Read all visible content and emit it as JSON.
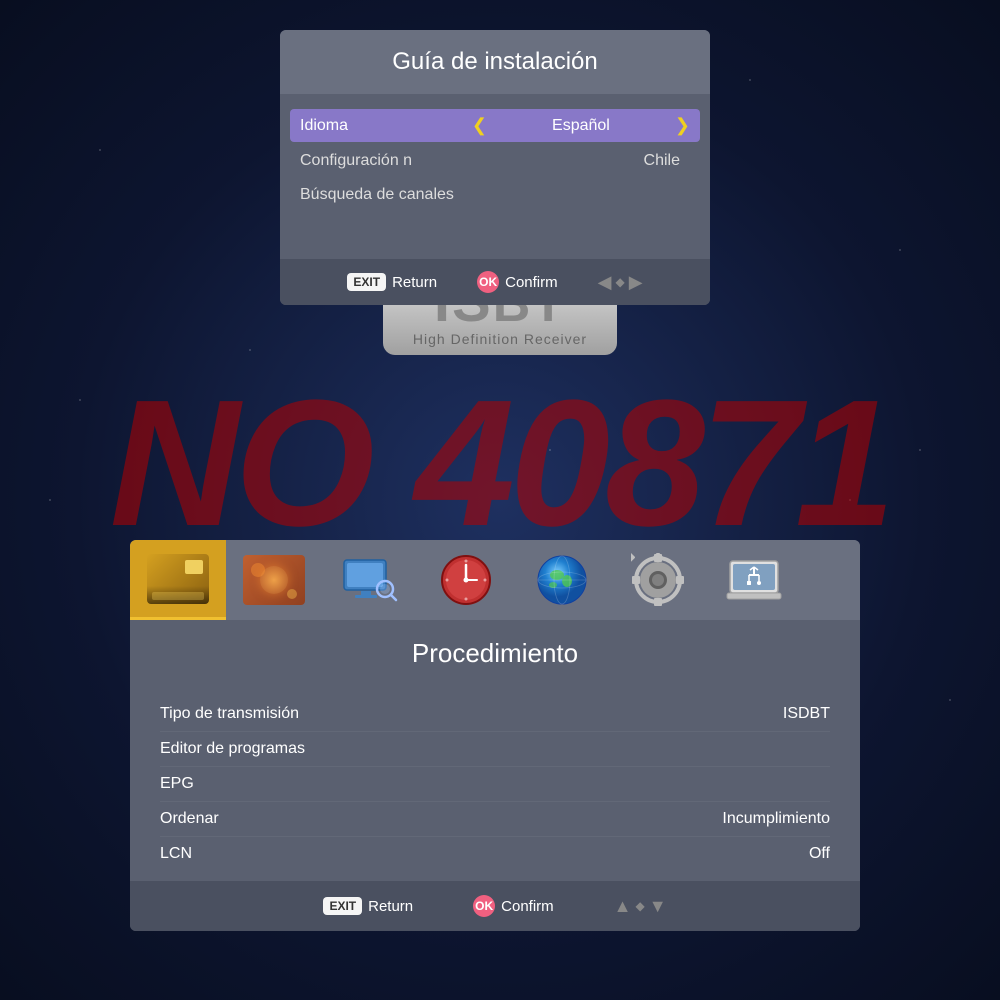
{
  "background": {
    "color": "#1a2540"
  },
  "watermark": {
    "text": "NO 40871"
  },
  "dialog_top": {
    "title": "Guía de instalación",
    "menu_items": [
      {
        "label": "Idioma",
        "value": "Español",
        "active": true,
        "has_arrows": true
      },
      {
        "label": "Configuración n",
        "value": "Chile",
        "active": false,
        "has_arrows": false
      },
      {
        "label": "Búsqueda de canales",
        "value": "",
        "active": false,
        "has_arrows": false
      }
    ],
    "footer": {
      "return_label": "Return",
      "confirm_label": "Confirm",
      "exit_badge": "EXIT",
      "ok_badge": "OK"
    }
  },
  "bottom_panel": {
    "icons": [
      {
        "name": "picture",
        "type": "picture",
        "selected": true
      },
      {
        "name": "bokeh",
        "type": "bokeh",
        "selected": false
      },
      {
        "name": "tv-search",
        "type": "tv-search",
        "selected": false
      },
      {
        "name": "clock",
        "type": "clock",
        "selected": false
      },
      {
        "name": "globe",
        "type": "globe",
        "selected": false
      },
      {
        "name": "gear",
        "type": "gear",
        "selected": false
      },
      {
        "name": "usb",
        "type": "usb",
        "selected": false
      }
    ],
    "title": "Procedimiento",
    "rows": [
      {
        "label": "Tipo de transmisión",
        "value": "ISDBT"
      },
      {
        "label": "Editor de programas",
        "value": ""
      },
      {
        "label": "EPG",
        "value": ""
      },
      {
        "label": "Ordenar",
        "value": "Incumplimiento"
      },
      {
        "label": "LCN",
        "value": "Off"
      }
    ],
    "footer": {
      "return_label": "Return",
      "confirm_label": "Confirm",
      "exit_badge": "EXIT",
      "ok_badge": "OK"
    }
  },
  "logo": {
    "main": "ISBT",
    "sub": "High Definition Receiver"
  }
}
